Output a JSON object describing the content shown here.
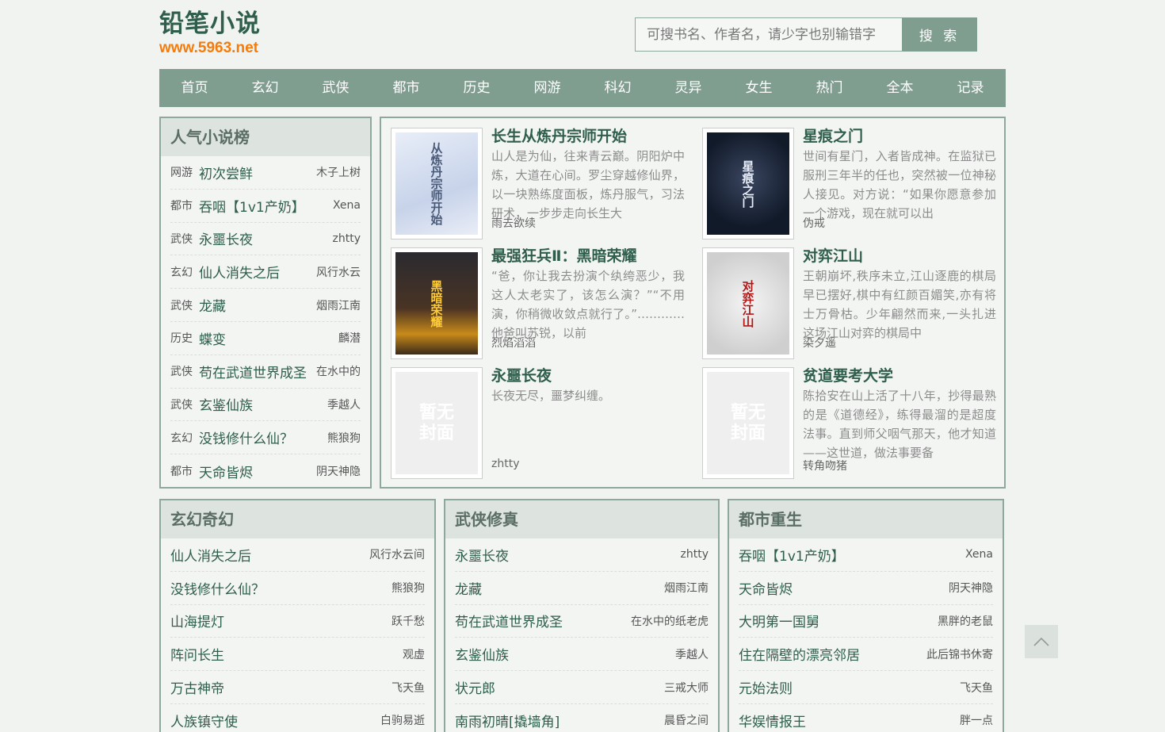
{
  "logo": {
    "title": "铅笔小说",
    "url": "www.5963.net"
  },
  "search": {
    "placeholder": "可搜书名、作者名，请少字也别输错字",
    "button": "搜 索"
  },
  "nav": [
    "首页",
    "玄幻",
    "武侠",
    "都市",
    "历史",
    "网游",
    "科幻",
    "灵异",
    "女生",
    "热门",
    "全本",
    "记录"
  ],
  "rank": {
    "title": "人气小说榜",
    "items": [
      {
        "cat": "网游",
        "title": "初次尝鲜",
        "author": "木子上树"
      },
      {
        "cat": "都市",
        "title": "吞咽【1v1产奶】",
        "author": "Xena"
      },
      {
        "cat": "武侠",
        "title": "永噩长夜",
        "author": "zhtty"
      },
      {
        "cat": "玄幻",
        "title": "仙人消失之后",
        "author": "风行水云"
      },
      {
        "cat": "武侠",
        "title": "龙藏",
        "author": "烟雨江南"
      },
      {
        "cat": "历史",
        "title": "蝶变",
        "author": "麟潜"
      },
      {
        "cat": "武侠",
        "title": "苟在武道世界成圣",
        "author": "在水中的"
      },
      {
        "cat": "武侠",
        "title": "玄鉴仙族",
        "author": "季越人"
      },
      {
        "cat": "玄幻",
        "title": "没钱修什么仙？",
        "author": "熊狼狗"
      },
      {
        "cat": "都市",
        "title": "天命皆烬",
        "author": "阴天神隐"
      }
    ]
  },
  "featured": [
    {
      "title": "长生从炼丹宗师开始",
      "desc": "山人是为仙，往来青云巅。阴阳炉中炼，大道在心间。罗尘穿越修仙界，以一块熟练度面板，炼丹服气，习法研术，一步步走向长生大",
      "author": "雨去欲续",
      "cover": "从炼丹宗师开始"
    },
    {
      "title": "星痕之门",
      "desc": "世间有星门，入者皆成神。在监狱已服刑三年半的任也，突然被一位神秘人接见。对方说：“如果你愿意参加一个游戏，现在就可以出",
      "author": "伪戒",
      "cover": "星痕之门"
    },
    {
      "title": "最强狂兵Ⅱ：黑暗荣耀",
      "desc": "“爸，你让我去扮演个纨绔恶少，我这人太老实了，该怎么演？”“不用演，你稍微收敛点就行了。”…………他爸叫苏锐，以前",
      "author": "烈焰滔滔",
      "cover": "黑暗荣耀"
    },
    {
      "title": "对弈江山",
      "desc": "王朝崩坏,秩序未立,江山逐鹿的棋局早已摆好,棋中有红颜百媚笑,亦有将士万骨枯。少年翩然而来,一头扎进这场江山对弈的棋局中",
      "author": "染夕遥",
      "cover": "对弈江山"
    },
    {
      "title": "永噩长夜",
      "desc": "长夜无尽，噩梦纠缠。",
      "author": "zhtty",
      "cover": "暂无封面"
    },
    {
      "title": "贫道要考大学",
      "desc": "陈拾安在山上活了十八年，抄得最熟的是《道德经》，练得最溜的是超度法事。直到师父咽气那天，他才知道——这世道，做法事要备",
      "author": "转角吻猪",
      "cover": "暂无封面"
    }
  ],
  "categories": [
    {
      "title": "玄幻奇幻",
      "items": [
        {
          "title": "仙人消失之后",
          "author": "风行水云间"
        },
        {
          "title": "没钱修什么仙？",
          "author": "熊狼狗"
        },
        {
          "title": "山海提灯",
          "author": "跃千愁"
        },
        {
          "title": "阵问长生",
          "author": "观虚"
        },
        {
          "title": "万古神帝",
          "author": "飞天鱼"
        },
        {
          "title": "人族镇守使",
          "author": "白驹易逝"
        }
      ]
    },
    {
      "title": "武侠修真",
      "items": [
        {
          "title": "永噩长夜",
          "author": "zhtty"
        },
        {
          "title": "龙藏",
          "author": "烟雨江南"
        },
        {
          "title": "苟在武道世界成圣",
          "author": "在水中的纸老虎"
        },
        {
          "title": "玄鉴仙族",
          "author": "季越人"
        },
        {
          "title": "状元郎",
          "author": "三戒大师"
        },
        {
          "title": "南雨初晴[撬墙角]",
          "author": "晨昏之间"
        }
      ]
    },
    {
      "title": "都市重生",
      "items": [
        {
          "title": "吞咽【1v1产奶】",
          "author": "Xena"
        },
        {
          "title": "天命皆烬",
          "author": "阴天神隐"
        },
        {
          "title": "大明第一国舅",
          "author": "黑胖的老鼠"
        },
        {
          "title": "住在隔壁的漂亮邻居",
          "author": "此后锦书休寄"
        },
        {
          "title": "元始法则",
          "author": "飞天鱼"
        },
        {
          "title": "华娱情报王",
          "author": "胖一点"
        }
      ]
    }
  ]
}
